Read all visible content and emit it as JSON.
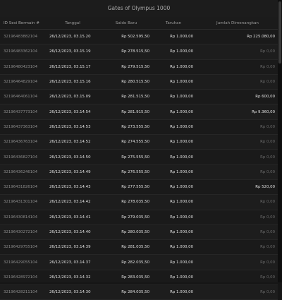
{
  "title": "Gates of Olympus 1000",
  "columns": [
    "ID Sesi Bermain #",
    "Tanggal",
    "Saldo Baru",
    "Taruhan",
    "Jumlah Dimenangkan"
  ],
  "rows": [
    {
      "id": "32196483882104",
      "date": "26/12/2023, 03.15.20",
      "saldo": "Rp 502.595,50",
      "taruhan": "Rp 1.000,00",
      "win": "Rp 225.080,00"
    },
    {
      "id": "32196483362104",
      "date": "26/12/2023, 03.15.19",
      "saldo": "Rp 278.515,50",
      "taruhan": "Rp 1.000,00",
      "win": "Rp 0,00"
    },
    {
      "id": "32196480423104",
      "date": "26/12/2023, 03.15.17",
      "saldo": "Rp 279.515,50",
      "taruhan": "Rp 1.000,00",
      "win": "Rp 0,00"
    },
    {
      "id": "32196464829104",
      "date": "26/12/2023, 03.15.16",
      "saldo": "Rp 280.515,50",
      "taruhan": "Rp 1.000,00",
      "win": "Rp 0,00"
    },
    {
      "id": "32196464061104",
      "date": "26/12/2023, 03.15.09",
      "saldo": "Rp 281.515,50",
      "taruhan": "Rp 1.000,00",
      "win": "Rp 600,00"
    },
    {
      "id": "32196437773104",
      "date": "26/12/2023, 03.14.54",
      "saldo": "Rp 281.915,50",
      "taruhan": "Rp 1.000,00",
      "win": "Rp 9.360,00"
    },
    {
      "id": "32196437363104",
      "date": "26/12/2023, 03.14.53",
      "saldo": "Rp 273.555,50",
      "taruhan": "Rp 1.000,00",
      "win": "Rp 0,00"
    },
    {
      "id": "32196436763104",
      "date": "26/12/2023, 03.14.52",
      "saldo": "Rp 274.555,50",
      "taruhan": "Rp 1.000,00",
      "win": "Rp 0,00"
    },
    {
      "id": "32196436827104",
      "date": "26/12/2023, 03.14.50",
      "saldo": "Rp 275.555,50",
      "taruhan": "Rp 1.000,00",
      "win": "Rp 0,00"
    },
    {
      "id": "32196436246104",
      "date": "26/12/2023, 03.14.49",
      "saldo": "Rp 276.555,50",
      "taruhan": "Rp 1.000,00",
      "win": "Rp 0,00"
    },
    {
      "id": "32196431826104",
      "date": "26/12/2023, 03.14.43",
      "saldo": "Rp 277.555,50",
      "taruhan": "Rp 1.000,00",
      "win": "Rp 520,00"
    },
    {
      "id": "32196431301104",
      "date": "26/12/2023, 03.14.42",
      "saldo": "Rp 278.035,50",
      "taruhan": "Rp 1.000,00",
      "win": "Rp 0,00"
    },
    {
      "id": "32196430814104",
      "date": "26/12/2023, 03.14.41",
      "saldo": "Rp 279.035,50",
      "taruhan": "Rp 1.000,00",
      "win": "Rp 0,00"
    },
    {
      "id": "32196430272104",
      "date": "26/12/2023, 03.14.40",
      "saldo": "Rp 280.035,50",
      "taruhan": "Rp 1.000,00",
      "win": "Rp 0,00"
    },
    {
      "id": "32196429755104",
      "date": "26/12/2023, 03.14.39",
      "saldo": "Rp 281.035,50",
      "taruhan": "Rp 1.000,00",
      "win": "Rp 0,00"
    },
    {
      "id": "32196429055104",
      "date": "26/12/2023, 03.14.37",
      "saldo": "Rp 282.035,50",
      "taruhan": "Rp 1.000,00",
      "win": "Rp 0,00"
    },
    {
      "id": "32196428972104",
      "date": "26/12/2023, 03.14.32",
      "saldo": "Rp 283.035,50",
      "taruhan": "Rp 1.000,00",
      "win": "Rp 0,00"
    },
    {
      "id": "32196428211104",
      "date": "26/12/2023, 03.14.30",
      "saldo": "Rp 284.035,50",
      "taruhan": "Rp 1.000,00",
      "win": "Rp 0,00"
    }
  ],
  "colors": {
    "zero_win": "#6a6a6a",
    "positive_win": "#e0e0e0",
    "background": "#1a1a1a"
  }
}
